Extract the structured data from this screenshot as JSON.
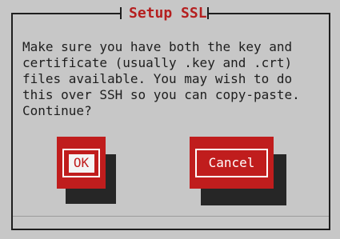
{
  "dialog": {
    "title": "Setup SSL",
    "message_lines": [
      "Make sure you have both the key and",
      "certificate (usually .key and .crt)",
      "files available. You may wish to do",
      "this over SSH so you can copy-paste.",
      "Continue?"
    ],
    "buttons": {
      "ok_label": "OK",
      "cancel_label": "Cancel"
    }
  },
  "colors": {
    "background": "#c7c7c7",
    "accent_red": "#c01d1d",
    "title_red": "#b51f1f",
    "frame": "#1e1e1e",
    "shadow": "#262626",
    "button_text": "#ffffff"
  }
}
